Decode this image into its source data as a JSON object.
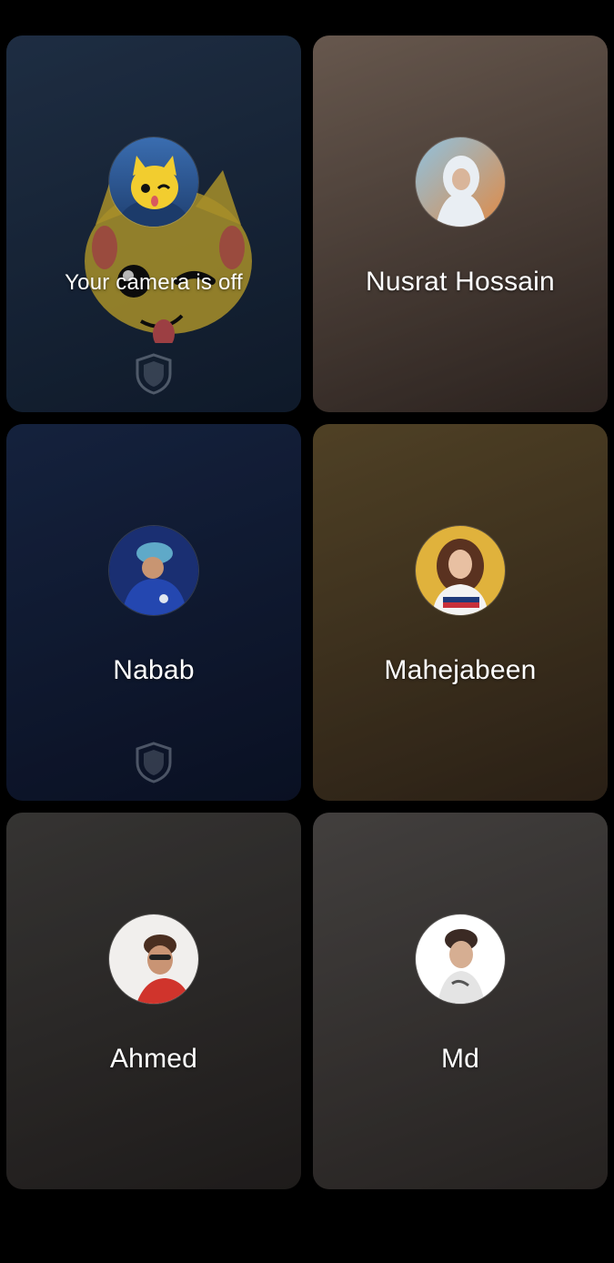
{
  "participants": [
    {
      "name": "Your camera is off",
      "is_self": true,
      "avatar_icon": "cat-emoji-avatar",
      "show_shield": true,
      "bg": [
        "#2a3f5c",
        "#15243a"
      ],
      "avatar_bg": [
        "#3a6db0",
        "#1f3f70"
      ]
    },
    {
      "name": "Nusrat Hossain",
      "is_self": false,
      "avatar_icon": "hijab-woman-avatar",
      "show_shield": false,
      "bg": [
        "#8f7a6c",
        "#3b2f2a"
      ],
      "avatar_bg": [
        "#d7e6f0",
        "#c98a5a"
      ]
    },
    {
      "name": "Nabab",
      "is_self": false,
      "avatar_icon": "man-blue-jacket-avatar",
      "show_shield": true,
      "bg": [
        "#1d2f55",
        "#0e1730"
      ],
      "avatar_bg": [
        "#2747a0",
        "#142a66"
      ]
    },
    {
      "name": "Mahejabeen",
      "is_self": false,
      "avatar_icon": "woman-tommy-shirt-avatar",
      "show_shield": false,
      "bg": [
        "#6e5a34",
        "#3a2c1e"
      ],
      "avatar_bg": [
        "#e6bb45",
        "#b8862a"
      ]
    },
    {
      "name": "Ahmed",
      "is_self": false,
      "avatar_icon": "man-sunglasses-avatar",
      "show_shield": false,
      "bg": [
        "#4a4846",
        "#2a2625"
      ],
      "avatar_bg": [
        "#f3f1ef",
        "#c9c3bd"
      ]
    },
    {
      "name": "Md",
      "is_self": false,
      "avatar_icon": "man-earring-avatar",
      "show_shield": false,
      "bg": [
        "#5c5856",
        "#35302e"
      ],
      "avatar_bg": [
        "#ffffff",
        "#d9d4d0"
      ]
    }
  ]
}
